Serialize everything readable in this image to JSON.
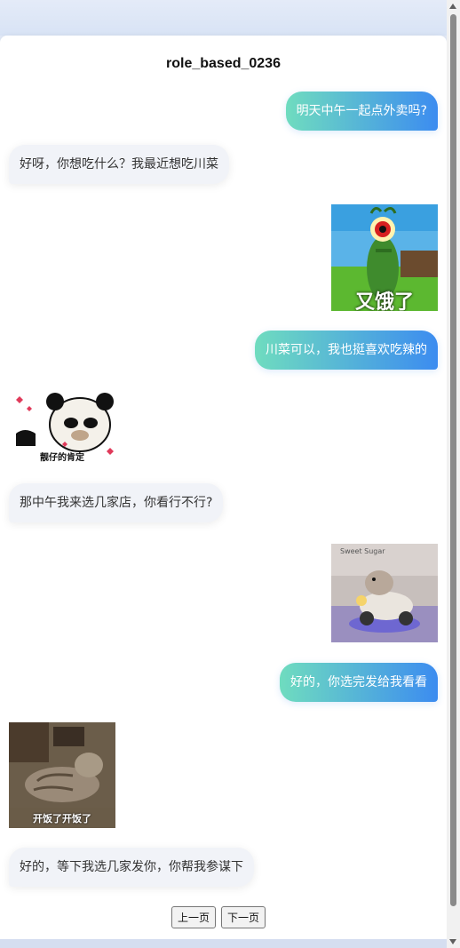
{
  "conversation": {
    "title": "role_based_0236",
    "messages": [
      {
        "type": "text",
        "side": "right",
        "text": "明天中午一起点外卖吗?"
      },
      {
        "type": "text",
        "side": "left",
        "text": "好呀，你想吃什么？我最近想吃川菜"
      },
      {
        "type": "image",
        "side": "right",
        "caption": "又饿了"
      },
      {
        "type": "text",
        "side": "right",
        "text": "川菜可以，我也挺喜欢吃辣的"
      },
      {
        "type": "image",
        "side": "left",
        "caption": "靓仔的肯定"
      },
      {
        "type": "text",
        "side": "left",
        "text": "那中午我来选几家店，你看行不行?"
      },
      {
        "type": "image",
        "side": "right",
        "caption": "Sweet Sugar"
      },
      {
        "type": "text",
        "side": "right",
        "text": "好的，你选完发给我看看"
      },
      {
        "type": "image",
        "side": "left",
        "caption": "开饭了开饭了"
      },
      {
        "type": "text",
        "side": "left",
        "text": "好的，等下我选几家发你，你帮我参谋下"
      }
    ]
  },
  "pagination": {
    "prev_label": "上一页",
    "next_label": "下一页"
  },
  "colors": {
    "bubble_gradient_start": "#6fdcbf",
    "bubble_gradient_end": "#3c8cf0",
    "left_bubble": "#f1f3f8"
  }
}
